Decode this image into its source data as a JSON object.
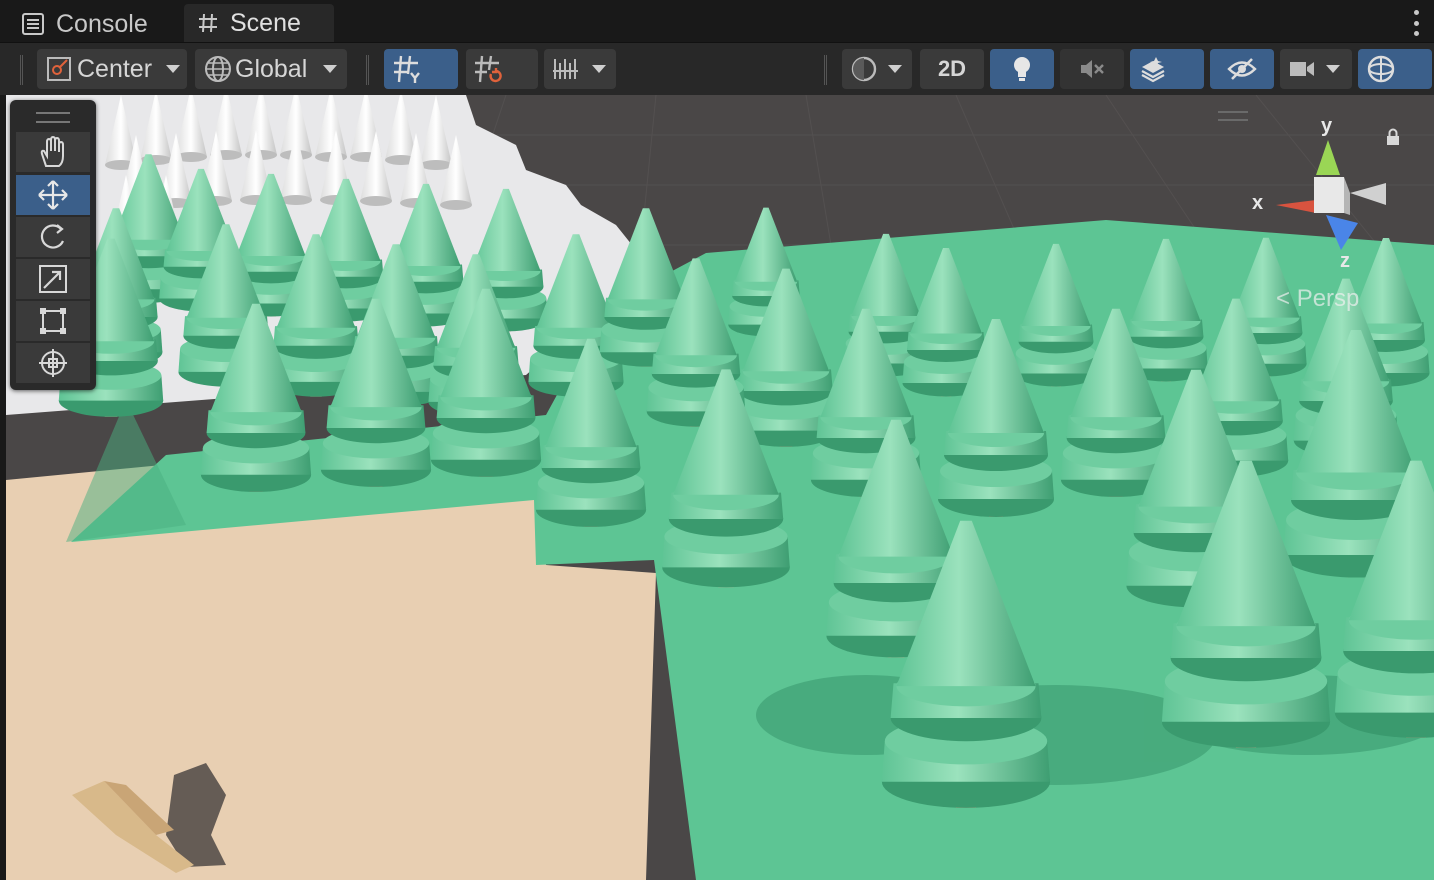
{
  "tabs": [
    {
      "label": "Console",
      "icon": "console-icon"
    },
    {
      "label": "Scene",
      "icon": "scene-grid-icon"
    }
  ],
  "toolbar": {
    "pivot_label": "Center",
    "space_label": "Global",
    "mode_2d_label": "2D",
    "lighting_on": true
  },
  "tools": [
    {
      "name": "hand-tool",
      "icon": "hand-icon",
      "active": false
    },
    {
      "name": "move-tool",
      "icon": "move-icon",
      "active": true
    },
    {
      "name": "rotate-tool",
      "icon": "rotate-icon",
      "active": false
    },
    {
      "name": "scale-tool",
      "icon": "scale-icon",
      "active": false
    },
    {
      "name": "rect-tool",
      "icon": "rect-transform-icon",
      "active": false
    },
    {
      "name": "transform-tool",
      "icon": "transform-icon",
      "active": false
    }
  ],
  "gizmo": {
    "x_label": "x",
    "y_label": "y",
    "z_label": "z",
    "projection_label": "Persp"
  },
  "colors": {
    "accent": "#3b5f8a",
    "tree": "#5fc495",
    "ground_green": "#5dc594",
    "ground_sand": "#e8cfb2",
    "snow": "#e8e8ea",
    "void": "#4b4848",
    "axis_x": "#d8533f",
    "axis_y": "#9ad655",
    "axis_z": "#4a85e8"
  }
}
